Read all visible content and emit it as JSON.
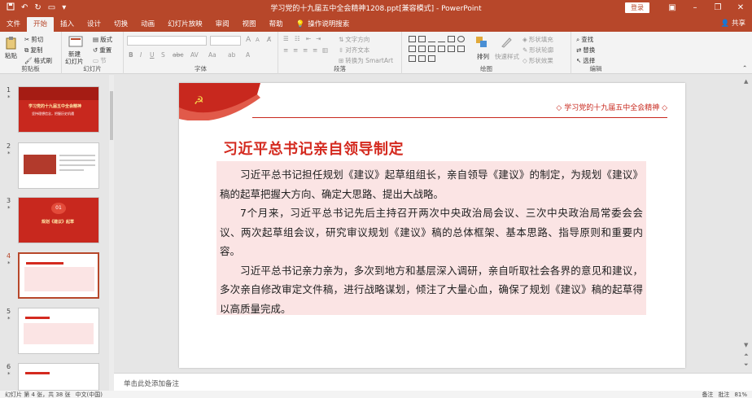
{
  "app": {
    "doc_title": "学习党的十九届五中全会精神1208.ppt[兼容模式]  -  PowerPoint",
    "login": "登录",
    "share": "共享",
    "accent": "#b7472a"
  },
  "tabs": [
    "文件",
    "开始",
    "插入",
    "设计",
    "切换",
    "动画",
    "幻灯片放映",
    "审阅",
    "视图",
    "帮助"
  ],
  "tab_active": "开始",
  "tell_me": "操作说明搜索",
  "ribbon": {
    "clipboard": {
      "paste": "粘贴",
      "cut": "剪切",
      "copy": "复制",
      "format_painter": "格式刷",
      "label": "剪贴板"
    },
    "slides": {
      "new_slide": "新建",
      "new_slide2": "幻灯片",
      "layout": "版式",
      "reset": "重置",
      "section": "节",
      "label": "幻灯片"
    },
    "font": {
      "label": "字体",
      "size_up": "A",
      "size_down": "A"
    },
    "paragraph": {
      "text_direction": "文字方向",
      "align_text": "对齐文本",
      "smartart": "转换为 SmartArt",
      "label": "段落"
    },
    "drawing": {
      "arrange": "排列",
      "quick_styles": "快速样式",
      "shape_fill": "形状填充",
      "shape_outline": "形状轮廓",
      "shape_effects": "形状效果",
      "label": "绘图"
    },
    "editing": {
      "find": "查找",
      "replace": "替换",
      "select": "选择",
      "label": "编辑"
    }
  },
  "thumbnails": [
    {
      "num": "1",
      "star": "*",
      "title": "学习党的十九届五中全会精神",
      "subtitle": "坚持理想信念，把握历史机遇"
    },
    {
      "num": "2",
      "star": "*"
    },
    {
      "num": "3",
      "star": "*",
      "badge": "01",
      "title": "规划《建议》起草"
    },
    {
      "num": "4",
      "star": "*"
    },
    {
      "num": "5",
      "star": "*"
    },
    {
      "num": "6",
      "star": "*"
    }
  ],
  "slide": {
    "header": "◇ 学习党的十九届五中全会精神 ◇",
    "title": "习近平总书记亲自领导制定",
    "paragraphs": [
      "习近平总书记担任规划《建议》起草组组长，亲自领导《建议》的制定，为规划《建议》稿的起草把握大方向、确定大思路、提出大战略。",
      "7个月来，习近平总书记先后主持召开两次中央政治局会议、三次中央政治局常委会会议、两次起草组会议，研究审议规划《建议》稿的总体框架、基本思路、指导原则和重要内容。",
      "习近平总书记亲力亲为，多次到地方和基层深入调研，亲自听取社会各界的意见和建议，多次亲自修改审定文件稿，进行战略谋划，倾注了大量心血，确保了规划《建议》稿的起草得以高质量完成。"
    ]
  },
  "notes_placeholder": "单击此处添加备注",
  "status": {
    "slide_info": "幻灯片 第 4 张，共 38 张",
    "language": "中文(中国)",
    "notes": "备注",
    "comments": "批注",
    "zoom": "81%"
  }
}
